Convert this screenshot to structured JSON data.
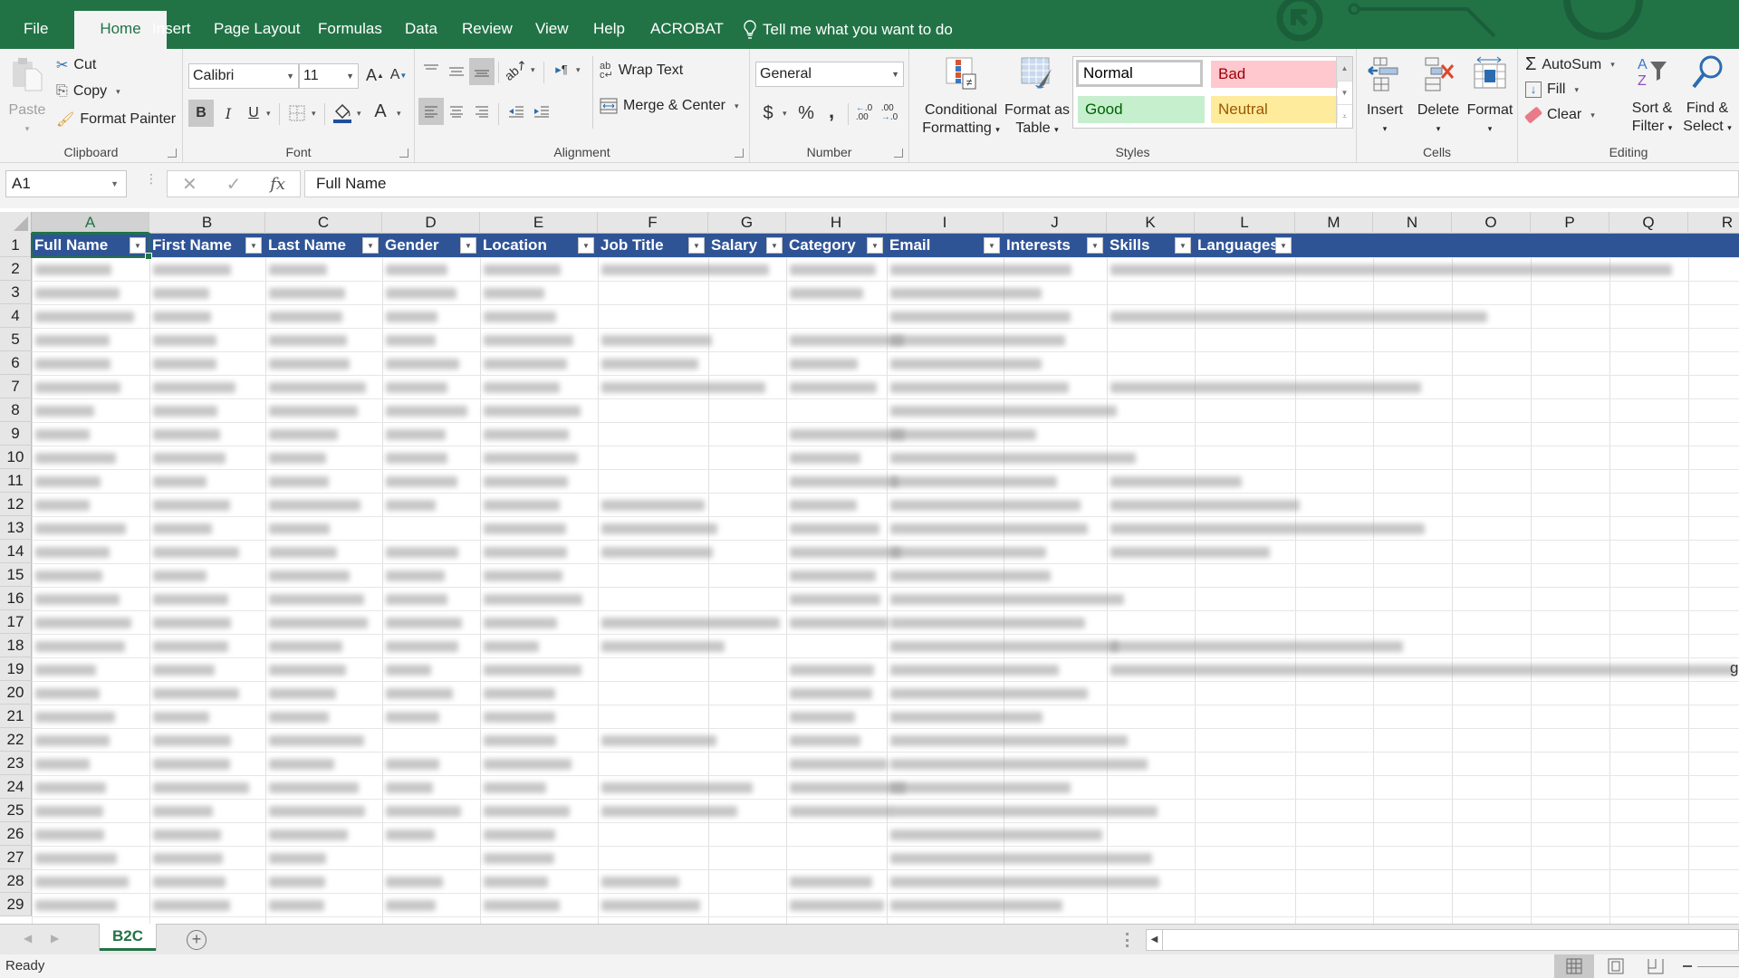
{
  "menu": {
    "tabs": [
      {
        "label": "File",
        "active": false
      },
      {
        "label": "Home",
        "active": true
      },
      {
        "label": "Insert",
        "active": false
      },
      {
        "label": "Page Layout",
        "active": false
      },
      {
        "label": "Formulas",
        "active": false
      },
      {
        "label": "Data",
        "active": false
      },
      {
        "label": "Review",
        "active": false
      },
      {
        "label": "View",
        "active": false
      },
      {
        "label": "Help",
        "active": false
      },
      {
        "label": "ACROBAT",
        "active": false
      }
    ],
    "tell_me": "Tell me what you want to do",
    "brand_color": "#217346"
  },
  "ribbon": {
    "clipboard": {
      "label": "Clipboard",
      "paste": "Paste",
      "cut": "Cut",
      "copy": "Copy",
      "format_painter": "Format Painter"
    },
    "font": {
      "label": "Font",
      "font_name": "Calibri",
      "font_size": "11",
      "bold": "B",
      "italic": "I",
      "underline": "U",
      "grow": "A",
      "shrink": "A",
      "font_color_glyph": "A"
    },
    "alignment": {
      "label": "Alignment",
      "wrap_text": "Wrap Text",
      "merge_center": "Merge & Center"
    },
    "number": {
      "label": "Number",
      "format": "General",
      "currency": "$",
      "percent": "%",
      "comma": ","
    },
    "styles": {
      "label": "Styles",
      "conditional_formatting": [
        "Conditional",
        "Formatting"
      ],
      "format_as_table": [
        "Format as",
        "Table"
      ],
      "cells": [
        {
          "label": "Normal",
          "bg": "#ffffff",
          "fg": "#000000"
        },
        {
          "label": "Bad",
          "bg": "#ffc7ce",
          "fg": "#9c0006"
        },
        {
          "label": "Good",
          "bg": "#c6efce",
          "fg": "#006100"
        },
        {
          "label": "Neutral",
          "bg": "#ffeb9c",
          "fg": "#9c5700"
        }
      ]
    },
    "cells": {
      "label": "Cells",
      "insert": "Insert",
      "delete": "Delete",
      "format": "Format"
    },
    "editing": {
      "label": "Editing",
      "autosum": "AutoSum",
      "fill": "Fill",
      "clear": "Clear",
      "sort_filter": [
        "Sort &",
        "Filter"
      ],
      "find_select": [
        "Find &",
        "Select"
      ]
    }
  },
  "formula_bar": {
    "name_box": "A1",
    "content": "Full Name",
    "fx": "fx"
  },
  "grid": {
    "columns": [
      "A",
      "B",
      "C",
      "D",
      "E",
      "F",
      "G",
      "H",
      "I",
      "J",
      "K",
      "L",
      "M",
      "N",
      "O",
      "P",
      "Q",
      "R"
    ],
    "selected_column": "A",
    "header_fill": "#2f5496",
    "table_headers": [
      "Full Name",
      "First Name",
      "Last Name",
      "Gender",
      "Location",
      "Job Title",
      "Salary",
      "Category",
      "Email",
      "Interests",
      "Skills",
      "Languages"
    ],
    "row_numbers": [
      "1",
      "2",
      "3",
      "4",
      "5",
      "6",
      "7",
      "8",
      "9",
      "10",
      "11",
      "12",
      "13",
      "14",
      "15",
      "16",
      "17",
      "18",
      "19",
      "20",
      "21",
      "22",
      "23",
      "24",
      "25",
      "26",
      "27",
      "28",
      "29"
    ],
    "data_note": "cell values blurred/redacted",
    "overflow_glyph": "g"
  },
  "sheets": {
    "tabs": [
      "B2C"
    ],
    "active": "B2C",
    "add": "+"
  },
  "status": {
    "text": "Ready"
  }
}
